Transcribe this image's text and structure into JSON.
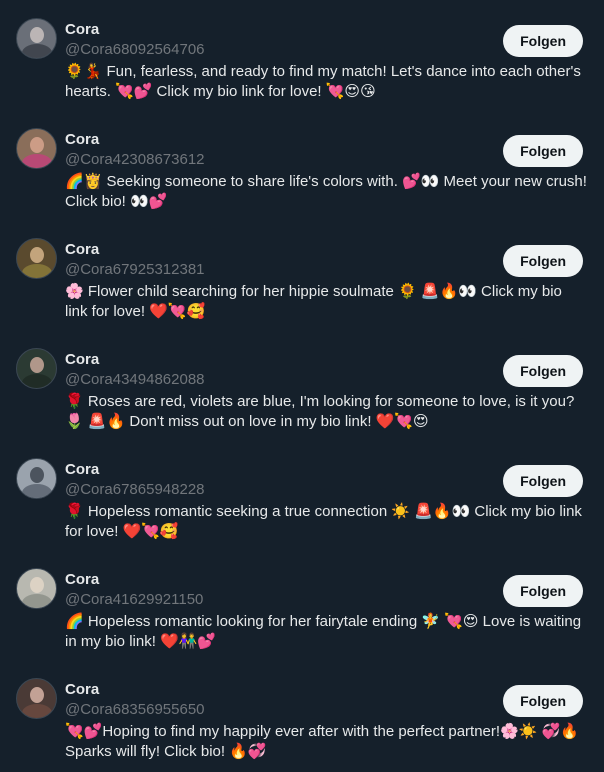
{
  "colors": {
    "background": "#15202b",
    "text_primary": "#e7e9ea",
    "text_secondary": "#71767b",
    "button_bg": "#eff3f4",
    "button_text": "#0f1419"
  },
  "users": [
    {
      "name": "Cora",
      "handle": "@Cora68092564706",
      "bio": "🌻💃 Fun, fearless, and ready to find my match! Let's dance into each other's hearts. 💘💕 Click my bio link for love! 💘😍😘",
      "follow_label": "Folgen",
      "avatar_colors": [
        "#6a6f78",
        "#c9c2c0",
        "#3a3f48"
      ]
    },
    {
      "name": "Cora",
      "handle": "@Cora42308673612",
      "bio": "🌈👸 Seeking someone to share life's colors with. 💕👀 Meet your new crush! Click bio! 👀💕",
      "follow_label": "Folgen",
      "avatar_colors": [
        "#8a6e5a",
        "#d7a58e",
        "#c0437a"
      ]
    },
    {
      "name": "Cora",
      "handle": "@Cora67925312381",
      "bio": "🌸 Flower child searching for her hippie soulmate 🌻 🚨🔥👀 Click my bio link for love! ❤️💘🥰",
      "follow_label": "Folgen",
      "avatar_colors": [
        "#5a4a2e",
        "#d6b48a",
        "#8b7a3a"
      ]
    },
    {
      "name": "Cora",
      "handle": "@Cora43494862088",
      "bio": "🌹 Roses are red, violets are blue, I'm looking for someone to love, is it you? 🌷 🚨🔥 Don't miss out on love in my bio link! ❤️💘😍",
      "follow_label": "Folgen",
      "avatar_colors": [
        "#2b3a33",
        "#c8a89a",
        "#1e2a24"
      ]
    },
    {
      "name": "Cora",
      "handle": "@Cora67865948228",
      "bio": "🌹 Hopeless romantic seeking a true connection ☀️ 🚨🔥👀 Click my bio link for love! ❤️💘🥰",
      "follow_label": "Folgen",
      "avatar_colors": [
        "#9aa3ad",
        "#3e4650",
        "#5a6470"
      ]
    },
    {
      "name": "Cora",
      "handle": "@Cora41629921150",
      "bio": "🌈 Hopeless romantic looking for her fairytale ending 🧚 💘😍 Love is waiting in my bio link! ❤️👫💕",
      "follow_label": "Folgen",
      "avatar_colors": [
        "#b8b8b0",
        "#e2d6c8",
        "#8c8f88"
      ]
    },
    {
      "name": "Cora",
      "handle": "@Cora68356955650",
      "bio": "💘💕Hoping to find my happily ever after with the perfect partner!🌸☀️ 💞🔥 Sparks will fly! Click bio! 🔥💞",
      "follow_label": "Folgen",
      "avatar_colors": [
        "#4a3a36",
        "#d8b4a6",
        "#6b4a40"
      ]
    }
  ]
}
